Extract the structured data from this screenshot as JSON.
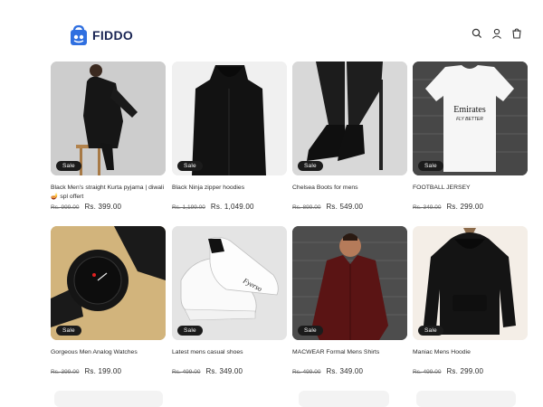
{
  "brand": {
    "name": "FIDDO"
  },
  "header": {
    "icons": [
      "search-icon",
      "account-icon",
      "cart-icon"
    ]
  },
  "products": [
    {
      "title": "Black Men's straight Kurta pyjama | diwali 🪔 spl offert",
      "badge": "Sale",
      "old_price": "Rs. 999.00",
      "price": "Rs. 399.00"
    },
    {
      "title": "Black Ninja zipper hoodies",
      "badge": "Sale",
      "old_price": "Rs. 1,199.00",
      "price": "Rs. 1,049.00"
    },
    {
      "title": "Chelsea Boots for mens",
      "badge": "Sale",
      "old_price": "Rs. 899.00",
      "price": "Rs. 549.00"
    },
    {
      "title": "FOOTBALL JERSEY",
      "badge": "Sale",
      "old_price": "Rs. 349.00",
      "price": "Rs. 299.00"
    },
    {
      "title": "Gorgeous Men Analog Watches",
      "badge": "Sale",
      "old_price": "Rs. 399.00",
      "price": "Rs. 199.00"
    },
    {
      "title": "Latest mens casual shoes",
      "badge": "Sale",
      "old_price": "Rs. 499.00",
      "price": "Rs. 349.00"
    },
    {
      "title": "MACWEAR Formal Mens Shirts",
      "badge": "Sale",
      "old_price": "Rs. 499.00",
      "price": "Rs. 349.00"
    },
    {
      "title": "Maniac Mens Hoodie",
      "badge": "Sale",
      "old_price": "Rs. 499.00",
      "price": "Rs. 299.00"
    }
  ],
  "jersey_print": {
    "line1": "Emirates",
    "line2": "FLY BETTER"
  },
  "shoe_print": "Fyerso",
  "colors": {
    "accent": "#2f6fe0",
    "badge_bg": "#1b1b1b",
    "text": "#1c1c1c"
  }
}
